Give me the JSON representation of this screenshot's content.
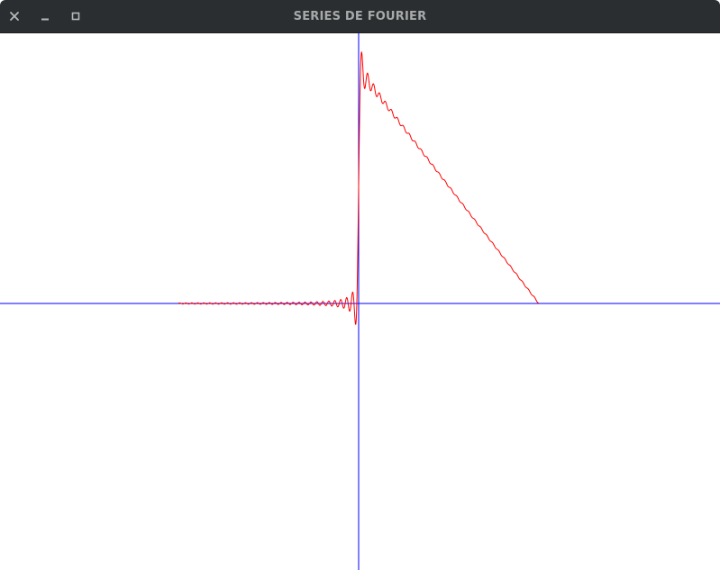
{
  "window": {
    "title": "SERIES DE FOURIER",
    "buttons": {
      "close_icon": "close-icon",
      "minimize_icon": "minimize-icon",
      "maximize_icon": "maximize-icon"
    }
  },
  "plot": {
    "axis_color": "#0000ff",
    "curve_color": "#ff0000",
    "titlebar_color": "#2b2e30"
  }
}
